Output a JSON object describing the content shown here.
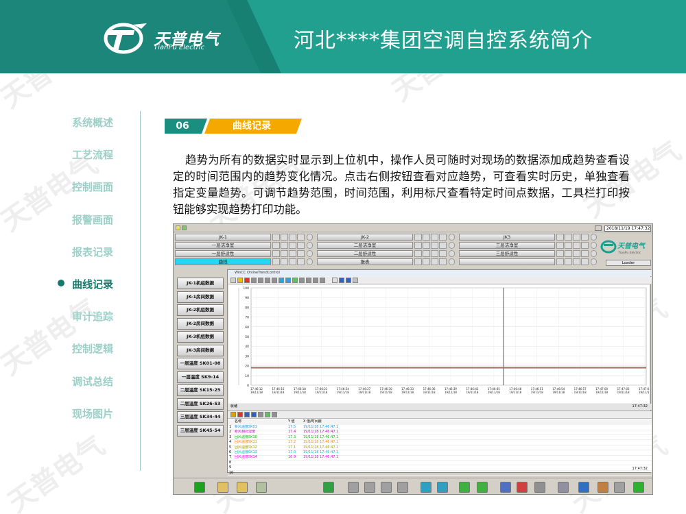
{
  "header": {
    "logo_cn": "天普电气",
    "logo_en": "TianPu Electric",
    "title": "河北****集团空调自控系统简介"
  },
  "sidebar": {
    "items": [
      {
        "label": "系统概述",
        "active": false
      },
      {
        "label": "工艺流程",
        "active": false
      },
      {
        "label": "控制画面",
        "active": false
      },
      {
        "label": "报警画面",
        "active": false
      },
      {
        "label": "报表记录",
        "active": false
      },
      {
        "label": "曲线记录",
        "active": true
      },
      {
        "label": "审计追踪",
        "active": false
      },
      {
        "label": "控制逻辑",
        "active": false
      },
      {
        "label": "调试总结",
        "active": false
      },
      {
        "label": "现场图片",
        "active": false
      }
    ]
  },
  "section": {
    "number": "06",
    "label": "曲线记录",
    "paragraph": "趋势为所有的数据实时显示到上位机中，操作人员可随时对现场的数据添加成趋势查看设定的时间范围内的趋势变化情况。点击右侧按钮查看对应趋势，可查看实时历史，单独查看指定变量趋势。可调节趋势范围，时间范围，利用标尺查看特定时间点数据，工具栏打印按钮能够实现趋势打印功能。"
  },
  "screen": {
    "datetime": "2018/11/19 17:47:32",
    "loader": "Loader",
    "grid_rows": [
      [
        "JK-1",
        "JK-2",
        "JK3"
      ],
      [
        "一层洁净室",
        "二层洁净室",
        "三层洁净室"
      ],
      [
        "一层舒适性",
        "二层舒适性",
        "三层舒适性"
      ],
      [
        "曲线",
        "报表",
        ""
      ]
    ],
    "left_buttons": [
      "JK-1机组数据",
      "JK-1房间数据",
      "JK-2机组数据",
      "JK-2房间数据",
      "JK-3机组数据",
      "JK-3房间数据",
      "一层温度 SK01-08",
      "一层温度 SK9-14",
      "二层温度 SK15-25",
      "二层温度 SK26-53",
      "三层温度 SK34-44",
      "三层温度 SK45-54"
    ],
    "trend_title": "WinCC OnlineTrendControl",
    "status_left": "就绪",
    "status_right": "17:47:32",
    "table_headers": [
      "名称",
      "Y 值",
      "X 值/时间戳"
    ],
    "table_rows": [
      {
        "name": "新风温度SK01",
        "y": "17.5",
        "x": "19/11/18 17:46:47.1",
        "color": "#00a0ff"
      },
      {
        "name": "新风相对湿度",
        "y": "17.4",
        "x": "19/11/18 17:46:47.1",
        "color": "#c000c0"
      },
      {
        "name": "回风温度SK10",
        "y": "17.3",
        "x": "19/11/18 17:46:47.1",
        "color": "#00c000"
      },
      {
        "name": "回风温度SK11",
        "y": "17.2",
        "x": "19/11/18 17:46:47.1",
        "color": "#ff8000"
      },
      {
        "name": "回风温度SK12",
        "y": "17.1",
        "x": "19/11/18 17:46:47.1",
        "color": "#a0a000"
      },
      {
        "name": "回风温度SK13",
        "y": "17.0",
        "x": "19/11/18 17:46:47.1",
        "color": "#00c0c0"
      },
      {
        "name": "回风温度SK14",
        "y": "16.9",
        "x": "19/11/18 17:46:47.1",
        "color": "#ff00ff"
      }
    ],
    "row_numbers": [
      "1",
      "2",
      "3",
      "4",
      "5",
      "6",
      "7",
      "8",
      "9",
      "10"
    ],
    "y_ticks": [
      "100",
      "90",
      "80",
      "70",
      "60",
      "50",
      "40",
      "30",
      "20",
      "10",
      "0"
    ],
    "x_ticks": [
      "17:46:12",
      "17:46:15",
      "17:46:18",
      "17:46:21",
      "17:46:24",
      "17:46:27",
      "17:46:30",
      "17:46:33",
      "17:46:36",
      "17:46:39",
      "17:46:42",
      "17:46:45",
      "17:46:48",
      "17:46:51",
      "17:46:54",
      "17:46:57",
      "17:47:00",
      "17:47:03",
      "17:47:06"
    ],
    "x_tick_date": "19/11/18",
    "footer_time": "17:47:32"
  },
  "watermark": "天普电气",
  "colors": {
    "teal": "#21a08f",
    "dark_teal": "#147a6c",
    "orange": "#f5a800"
  }
}
